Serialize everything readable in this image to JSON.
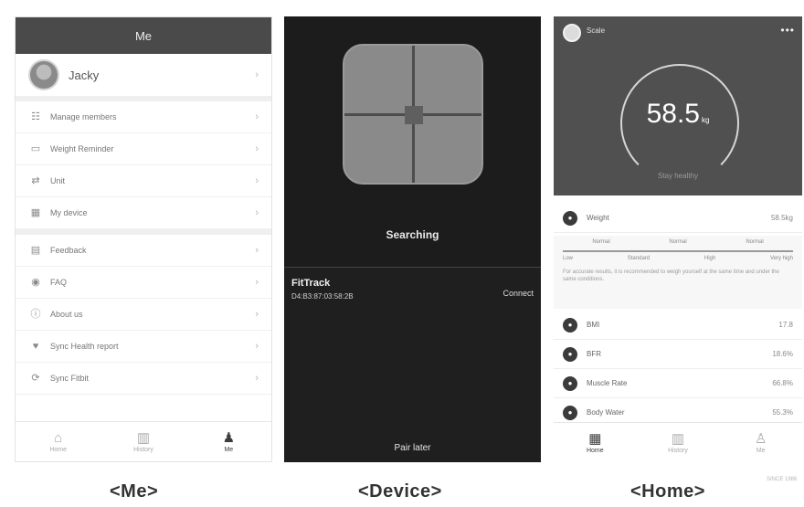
{
  "me": {
    "title": "Me",
    "user_name": "Jacky",
    "menu_group1": [
      {
        "icon": "people-icon",
        "glyph": "☷",
        "label": "Manage members"
      },
      {
        "icon": "scale-icon",
        "glyph": "▭",
        "label": "Weight Reminder"
      },
      {
        "icon": "unit-icon",
        "glyph": "⇄",
        "label": "Unit"
      },
      {
        "icon": "device-icon",
        "glyph": "▦",
        "label": "My device"
      }
    ],
    "menu_group2": [
      {
        "icon": "feedback-icon",
        "glyph": "▤",
        "label": "Feedback"
      },
      {
        "icon": "faq-icon",
        "glyph": "◉",
        "label": "FAQ"
      },
      {
        "icon": "info-icon",
        "glyph": "ⓘ",
        "label": "About us"
      },
      {
        "icon": "heart-icon",
        "glyph": "♥",
        "label": "Sync Health report"
      },
      {
        "icon": "sync-icon",
        "glyph": "⟳",
        "label": "Sync Fitbit"
      }
    ],
    "tabs": [
      {
        "icon": "home-tab-icon",
        "glyph": "⌂",
        "label": "Home"
      },
      {
        "icon": "history-tab-icon",
        "glyph": "▥",
        "label": "History"
      },
      {
        "icon": "me-tab-icon",
        "glyph": "♟",
        "label": "Me"
      }
    ]
  },
  "device": {
    "status": "Searching",
    "device_name": "FitTrack",
    "mac": "D4:B3:87:03:58:2B",
    "connect_label": "Connect",
    "pair_later": "Pair later"
  },
  "home": {
    "user": "Scale",
    "more": "•••",
    "weight_value": "58.5",
    "weight_unit": "kg",
    "status_text": "Stay healthy",
    "weight_row": {
      "label": "Weight",
      "value": "58.5kg"
    },
    "ranges_top": [
      "Normal",
      "Normal",
      "Normal"
    ],
    "ranges_bottom": [
      "Low",
      "Standard",
      "High",
      "Very high"
    ],
    "note": "For accurate results, it is recommended to weigh yourself at the same time and under the same conditions.",
    "metrics": [
      {
        "icon": "bmi-icon",
        "label": "BMI",
        "value": "17.8"
      },
      {
        "icon": "bfr-icon",
        "label": "BFR",
        "value": "18.6%"
      },
      {
        "icon": "muscle-icon",
        "label": "Muscle Rate",
        "value": "66.8%"
      },
      {
        "icon": "water-icon",
        "label": "Body Water",
        "value": "55.3%"
      }
    ],
    "tabs": [
      {
        "icon": "home-tab-icon",
        "glyph": "▦",
        "label": "Home"
      },
      {
        "icon": "history-tab-icon",
        "glyph": "▥",
        "label": "History"
      },
      {
        "icon": "me-tab-icon",
        "glyph": "♙",
        "label": "Me"
      }
    ]
  },
  "captions": {
    "me": "<Me>",
    "device": "<Device>",
    "home": "<Home>"
  },
  "watermark": "SINCE 1986"
}
